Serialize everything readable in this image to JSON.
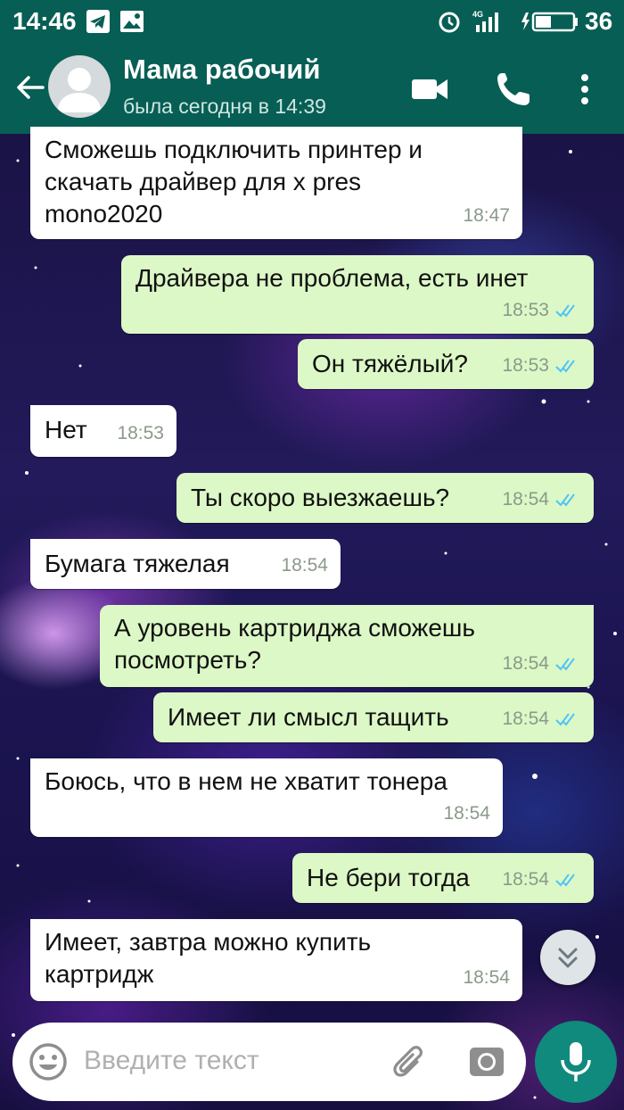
{
  "status_bar": {
    "time": "14:46",
    "network": "4G",
    "battery_percent": "36"
  },
  "header": {
    "contact_name": "Мама рабочий",
    "last_seen": "была сегодня в 14:39"
  },
  "messages": [
    {
      "direction": "in",
      "text": "Сможешь подключить принтер и\nскачать драйвер для x pres\nmono2020",
      "time": "18:47"
    },
    {
      "direction": "out",
      "text": "Драйвера не проблема,  есть инет",
      "time": "18:53"
    },
    {
      "direction": "out",
      "text": "Он тяжёлый?",
      "time": "18:53"
    },
    {
      "direction": "in",
      "text": "Нет",
      "time": "18:53"
    },
    {
      "direction": "out",
      "text": "Ты скоро выезжаешь?",
      "time": "18:54"
    },
    {
      "direction": "in",
      "text": "Бумага тяжелая",
      "time": "18:54"
    },
    {
      "direction": "out",
      "text": "А уровень картриджа сможешь\nпосмотреть?",
      "time": "18:54"
    },
    {
      "direction": "out",
      "text": "Имеет ли смысл тащить",
      "time": "18:54"
    },
    {
      "direction": "in",
      "text": "Боюсь, что в нем не хватит тонера",
      "time": "18:54"
    },
    {
      "direction": "out",
      "text": "Не бери тогда",
      "time": "18:54"
    },
    {
      "direction": "in",
      "text": "Имеет,  завтра можно купить\nкартридж",
      "time": "18:54"
    }
  ],
  "input": {
    "placeholder": "Введите текст"
  },
  "colors": {
    "header": "#075e54",
    "outgoing_bubble": "#dcf8c6",
    "incoming_bubble": "#ffffff",
    "read_ticks": "#4fc3f7",
    "mic_button": "#0f8a7c"
  },
  "icons": [
    "back-arrow-icon",
    "video-call-icon",
    "phone-icon",
    "more-vert-icon",
    "emoji-icon",
    "attach-icon",
    "camera-icon",
    "mic-icon",
    "scroll-down-icon"
  ]
}
